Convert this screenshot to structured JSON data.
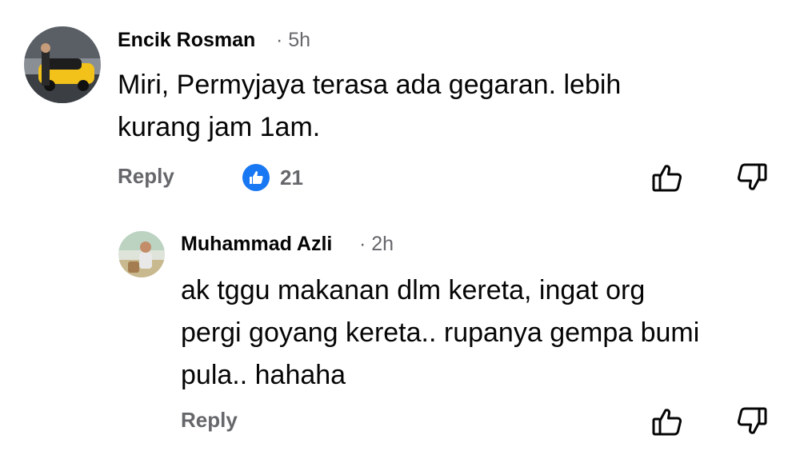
{
  "comments": [
    {
      "author": "Encik Rosman",
      "time": "· 5h",
      "text_lines": [
        "Miri, Permyjaya terasa ada gegaran. lebih",
        "kurang jam 1am."
      ],
      "reply_label": "Reply",
      "reaction_icon": "like-icon",
      "reaction_count": "21"
    },
    {
      "author": "Muhammad Azli",
      "time": "· 2h",
      "text_lines": [
        "ak tggu makanan dlm kereta, ingat org",
        "pergi goyang kereta.. rupanya gempa bumi",
        "pula.. hahaha"
      ],
      "reply_label": "Reply"
    }
  ],
  "colors": {
    "accent": "#1877f2",
    "secondary_text": "#65676b",
    "primary_text": "#050505"
  }
}
